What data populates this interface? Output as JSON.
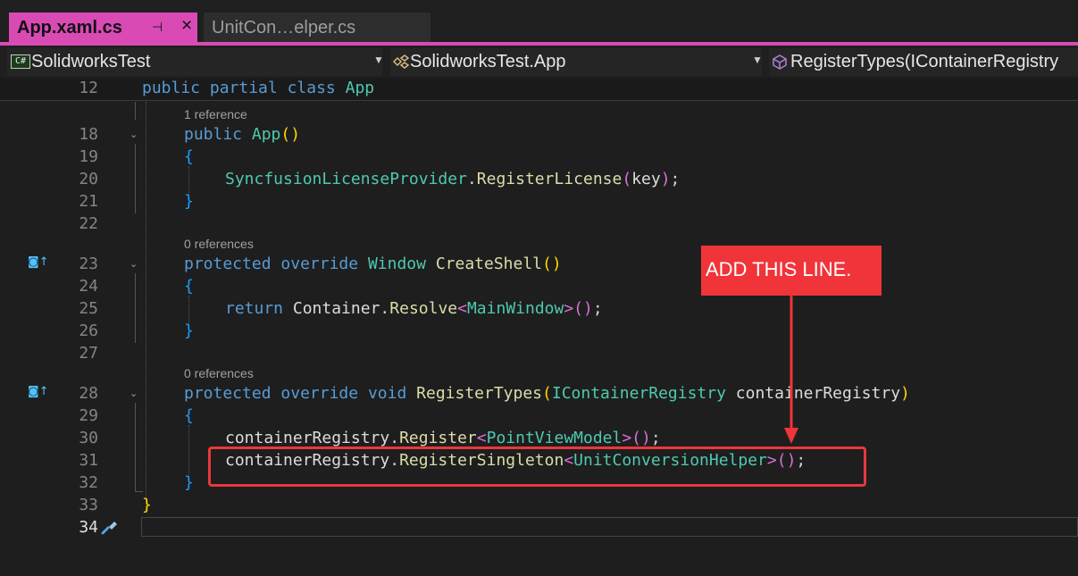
{
  "tabs": [
    {
      "title": "App.xaml.cs",
      "pin_icon": "pin-icon",
      "close_icon": "close-icon"
    },
    {
      "title": "UnitCon…elper.cs"
    }
  ],
  "nav": {
    "project": "SolidworksTest",
    "project_icon_text": "C#",
    "class": "SolidworksTest.App",
    "member": "RegisterTypes(IContainerRegistry"
  },
  "editor": {
    "sticky_line_number": "12",
    "lines": {
      "l18": "18",
      "l19": "19",
      "l20": "20",
      "l21": "21",
      "l22": "22",
      "l23": "23",
      "l24": "24",
      "l25": "25",
      "l26": "26",
      "l27": "27",
      "l28": "28",
      "l29": "29",
      "l30": "30",
      "l31": "31",
      "l32": "32",
      "l33": "33",
      "l34": "34"
    },
    "codelens": {
      "app_ctor": "1 reference",
      "create_shell": "0 references",
      "register_types": "0 references"
    },
    "tokens": {
      "public": "public",
      "partial": "partial",
      "class": "class",
      "App": "App",
      "protected": "protected",
      "override": "override",
      "void": "void",
      "return": "return",
      "Window": "Window",
      "CreateShell": "CreateShell",
      "SyncfusionLicenseProvider": "SyncfusionLicenseProvider",
      "RegisterLicense": "RegisterLicense",
      "key": "key",
      "Container": "Container",
      "Resolve": "Resolve",
      "MainWindow": "MainWindow",
      "RegisterTypes": "RegisterTypes",
      "IContainerRegistry": "IContainerRegistry",
      "containerRegistry": "containerRegistry",
      "Register": "Register",
      "PointViewModel": "PointViewModel",
      "RegisterSingleton": "RegisterSingleton",
      "UnitConversionHelper": "UnitConversionHelper"
    }
  },
  "annotation": {
    "callout_text": "ADD THIS LINE.",
    "color": "#f0343a"
  },
  "colors": {
    "tab_accent": "#d94ab5",
    "keyword": "#569cd6",
    "type": "#4ec9b0",
    "method": "#dcdcaa"
  }
}
